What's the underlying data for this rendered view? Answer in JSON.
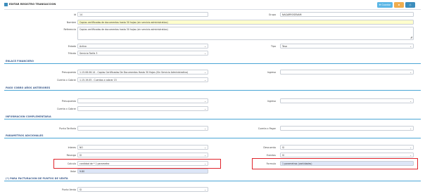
{
  "header": {
    "title": "EDITAR REGISTRO TRANSACCION",
    "save_label": "Guardar",
    "accent": "#3c8dbc",
    "save_color": "#5cb7e6",
    "warn_color": "#f0ad4e",
    "print_color": "#3c8dbc"
  },
  "form": {
    "id_label": "Id",
    "id_value": "14",
    "grupo_label": "Grupo",
    "grupo_value": "NAGARROSENAM",
    "nombre_label": "Nombre",
    "nombre_value": "Copias certificadas de documentos hasta 30 hojas (sin servicio administrativo)",
    "referencia_label": "Referencia",
    "referencia_value": "Copias certificadas de documentos hasta 30 hojas (sin servicio administrativo)",
    "estado_label": "Estado",
    "estado_value": "Activo",
    "tipo_label": "Tipo",
    "tipo_value": "Tasa",
    "tributo_label": "Tributo",
    "tributo_value": "Servicio Tarifa 3"
  },
  "sections": {
    "enlace": "ENLACE FINANCIERO",
    "pago": "PAGO COBRO AÑOS ANTERIORES",
    "info": "INFORMACION COMPLEMENTARIA",
    "param": "PARAMETROS ADICIONALES",
    "pos": "(*) PARA FACTURACION DE PUNTOS DE VENTA"
  },
  "enlace": {
    "presupuesto_label": "Presupuesto",
    "presupuesto_value": "1.15.06.06.14 - Copias Certificadas De Documentos Hasta 30 Hojas (Sin Servicio Administrativo)",
    "ingreso_label": "Ingreso",
    "ingreso_value": "",
    "cuenta_label": "Cuenta x Cobrar",
    "cuenta_value": "1.15.19.05 - Cuentas x cobrar 15"
  },
  "pago": {
    "presupuesto_label": "Presupuesto",
    "ingreso_label": "Ingreso",
    "cuenta_label": "Cuenta x Cobrar"
  },
  "info": {
    "punto_label": "Punto Tarifario",
    "cuenta_pagar_label": "Cuenta x Pagar"
  },
  "param": {
    "interes_label": "Interes",
    "interes_value": "NO",
    "descuento_label": "Descuento",
    "descuento_value": "SI",
    "recargo_label": "Recargo",
    "recargo_value": "SI",
    "exentos_label": "Exentos",
    "exentos_value": "SI",
    "calculo_label": "Calculo",
    "calculo_value": "cantidad de * 1 parametro",
    "formula_label": "Formula",
    "formula_value": "1 parametros (cantidades)",
    "valor_label": "Valor",
    "valor_value": "9.80"
  },
  "pos": {
    "punto_venta_label": "Punto Venta",
    "punto_venta_value": "SI"
  }
}
